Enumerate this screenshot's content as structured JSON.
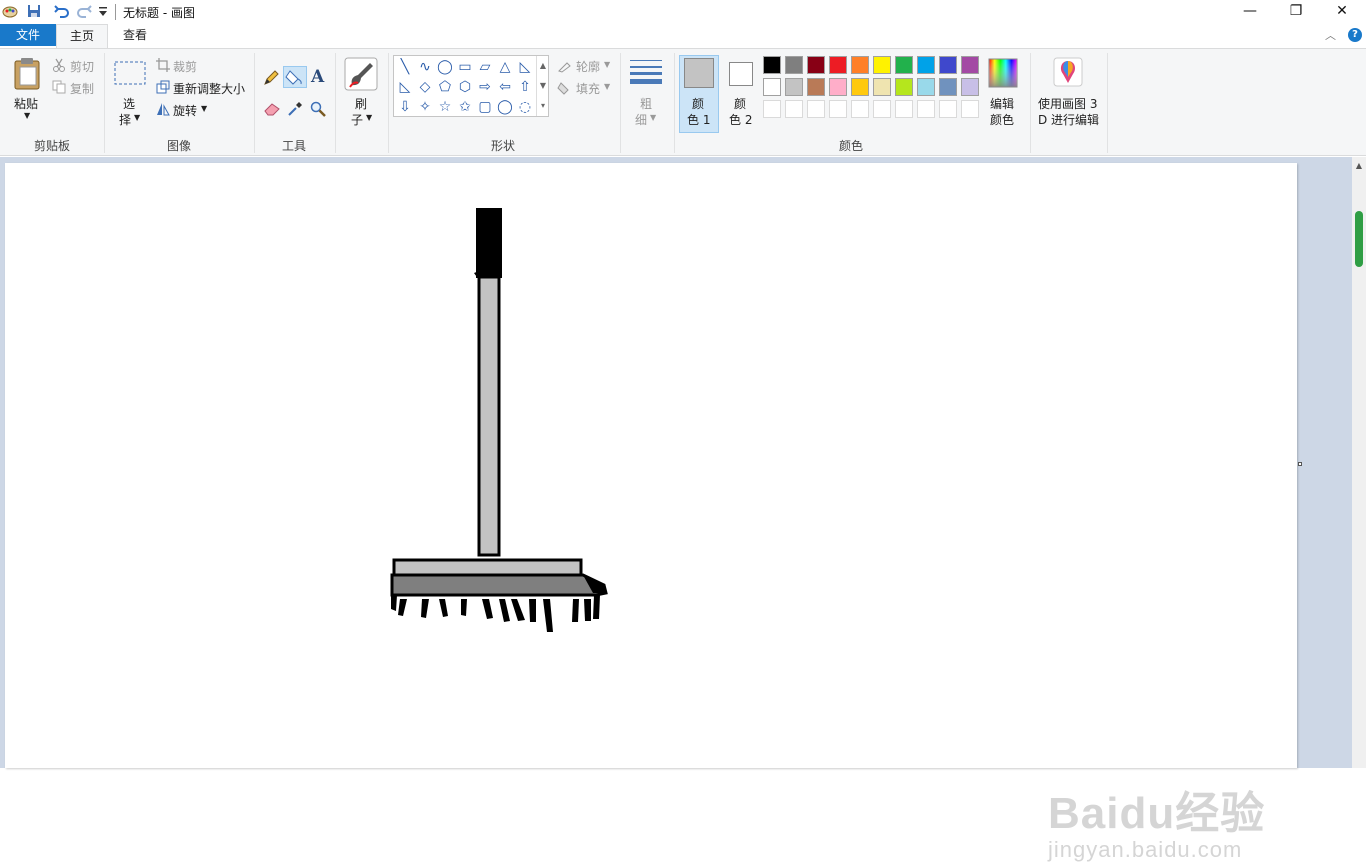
{
  "window": {
    "title": "无标题 - 画图",
    "minimize": "—",
    "maximize": "❐",
    "close": "✕"
  },
  "tabs": {
    "file": "文件",
    "home": "主页",
    "view": "查看"
  },
  "clipboard": {
    "paste": "粘贴",
    "cut": "剪切",
    "copy": "复制",
    "group": "剪贴板"
  },
  "image": {
    "select_1": "选",
    "select_2": "择",
    "crop": "裁剪",
    "resize": "重新调整大小",
    "rotate": "旋转",
    "group": "图像"
  },
  "tools": {
    "group": "工具",
    "text_glyph": "A"
  },
  "brushes": {
    "label_1": "刷",
    "label_2": "子"
  },
  "shapes": {
    "group": "形状",
    "outline": "轮廓",
    "fill": "填充",
    "glyphs": [
      "╲",
      "∿",
      "◯",
      "▭",
      "▱",
      "△",
      "◺",
      "◇",
      "⬠",
      "⬡",
      "⇨",
      "⇦",
      "⇧",
      "⇩",
      "✧",
      "☆",
      "✩",
      "▢",
      "◯",
      "◌"
    ]
  },
  "size": {
    "label_1": "粗",
    "label_2": "细"
  },
  "colors": {
    "color1_label_1": "颜",
    "color1_label_2": "色 1",
    "color2_label_1": "颜",
    "color2_label_2": "色 2",
    "color1": "#c3c3c3",
    "color2": "#ffffff",
    "edit_label_1": "编辑",
    "edit_label_2": "颜色",
    "group": "颜色",
    "palette_row1": [
      "#000000",
      "#7f7f7f",
      "#880015",
      "#ed1c24",
      "#ff7f27",
      "#fff200",
      "#22b14c",
      "#00a2e8",
      "#3f48cc",
      "#a349a4"
    ],
    "palette_row2": [
      "#ffffff",
      "#c3c3c3",
      "#b97a57",
      "#ffaec9",
      "#ffc90e",
      "#efe4b0",
      "#b5e61d",
      "#99d9ea",
      "#7092be",
      "#c8bfe7"
    ]
  },
  "paint3d": {
    "label_1": "使用画图 3",
    "label_2": "D 进行编辑"
  },
  "watermark": {
    "main": "Baidu经验",
    "sub": "jingyan.baidu.com"
  }
}
